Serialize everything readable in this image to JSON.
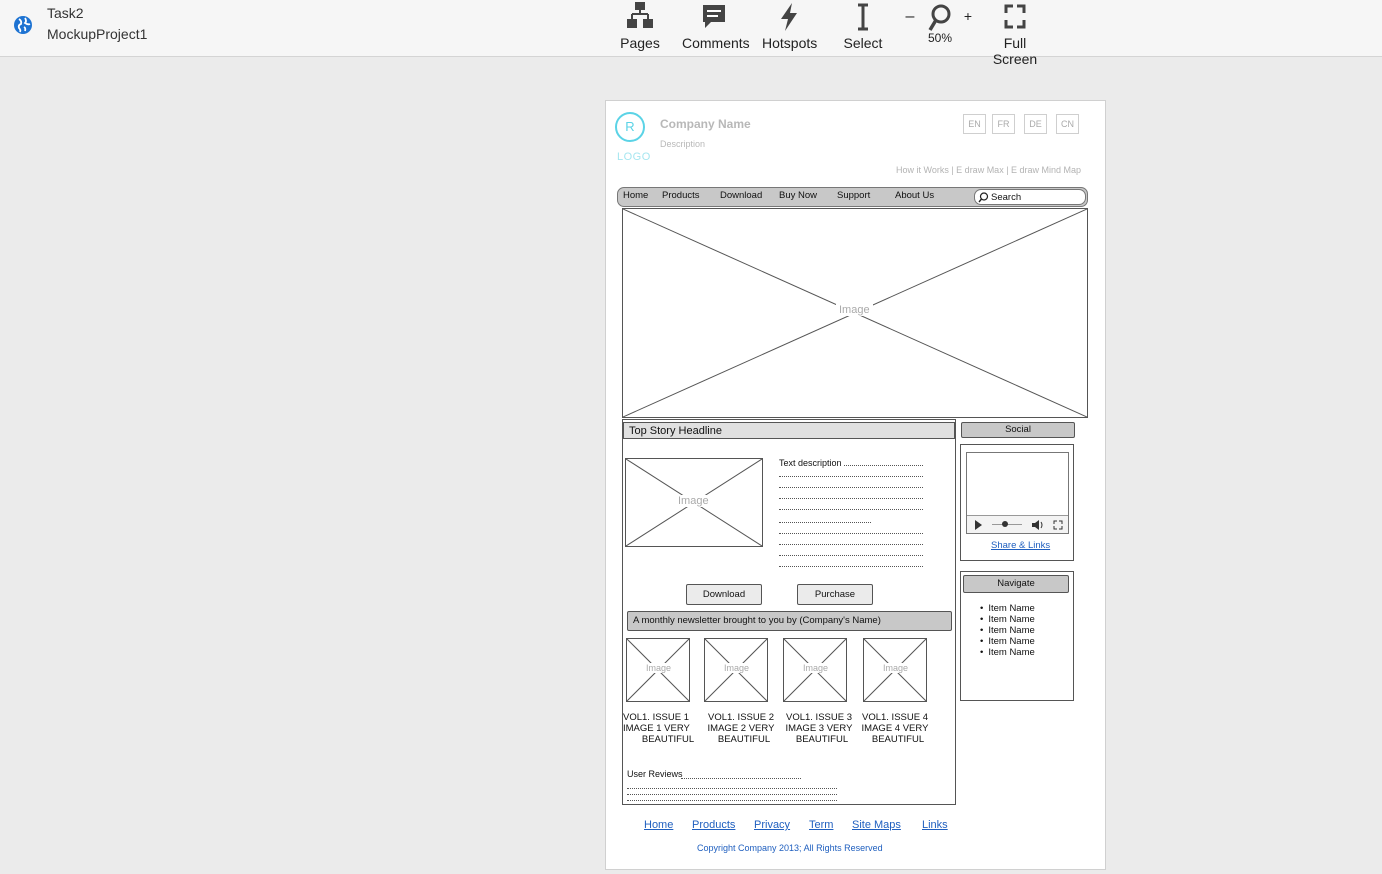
{
  "project": {
    "title": "Task2",
    "subtitle": "MockupProject1"
  },
  "toolbar": {
    "pages": "Pages",
    "comments": "Comments",
    "hotspots": "Hotspots",
    "select": "Select",
    "zoom_minus": "–",
    "zoom_plus": "+",
    "zoom_level": "50%",
    "fullscreen": "Full Screen"
  },
  "mockup": {
    "logo_letter": "R",
    "logo_text": "LOGO",
    "company_name": "Company Name",
    "description": "Description",
    "languages": [
      "EN",
      "FR",
      "DE",
      "CN"
    ],
    "top_links": "How it Works  |  E draw Max  |  E draw Mind Map",
    "nav": [
      "Home",
      "Products",
      "Download",
      "Buy Now",
      "Support",
      "About Us"
    ],
    "search_placeholder": "Search",
    "hero_image": "Image",
    "headline": "Top Story Headline",
    "story_image": "Image",
    "text_description": "Text description",
    "download_button": "Download",
    "purchase_button": "Purchase",
    "newsletter": "A monthly newsletter brought to you by (Company's Name)",
    "thumb_image": "Image",
    "issues": [
      {
        "l1": "VOL1. ISSUE 1",
        "l2": "IMAGE 1 VERY",
        "l3": "BEAUTIFUL"
      },
      {
        "l1": "VOL1. ISSUE 2",
        "l2": "IMAGE 2 VERY",
        "l3": "BEAUTIFUL"
      },
      {
        "l1": "VOL1. ISSUE 3",
        "l2": "IMAGE 3 VERY",
        "l3": "BEAUTIFUL"
      },
      {
        "l1": "VOL1. ISSUE 4",
        "l2": "IMAGE 4 VERY",
        "l3": "BEAUTIFUL"
      }
    ],
    "user_reviews": "User Reviews",
    "social_title": "Social",
    "share_links": "Share & Links",
    "navigate_title": "Navigate",
    "navigate_items": [
      "Item Name",
      "Item Name",
      "Item Name",
      "Item Name",
      "Item Name"
    ],
    "footer_links": [
      "Home",
      "Products",
      "Privacy",
      "Term",
      "Site Maps",
      "Links"
    ],
    "copyright": "Copyright Company 2013; All Rights Reserved"
  }
}
